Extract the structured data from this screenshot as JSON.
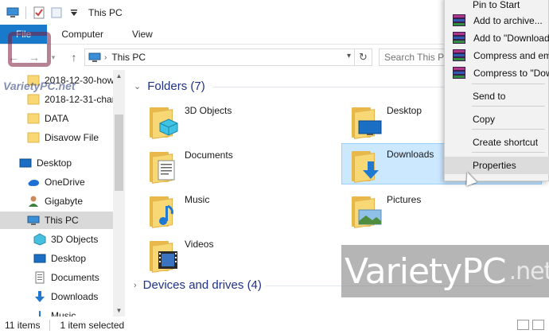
{
  "window": {
    "title": "This PC"
  },
  "ribbon": {
    "tabs": [
      {
        "label": "File"
      },
      {
        "label": "Computer"
      },
      {
        "label": "View"
      }
    ]
  },
  "address": {
    "path": "This PC",
    "search_placeholder": "Search This PC"
  },
  "sidebar": {
    "items": [
      {
        "label": "2018-12-30-how"
      },
      {
        "label": "2018-12-31-char"
      },
      {
        "label": "DATA"
      },
      {
        "label": "Disavow File"
      },
      {
        "label": "Desktop"
      },
      {
        "label": "OneDrive"
      },
      {
        "label": "Gigabyte"
      },
      {
        "label": "This PC"
      },
      {
        "label": "3D Objects"
      },
      {
        "label": "Desktop"
      },
      {
        "label": "Documents"
      },
      {
        "label": "Downloads"
      },
      {
        "label": "Music"
      }
    ]
  },
  "main": {
    "folders_header": "Folders (7)",
    "folders": [
      {
        "label": "3D Objects"
      },
      {
        "label": "Desktop"
      },
      {
        "label": "Documents"
      },
      {
        "label": "Downloads"
      },
      {
        "label": "Music"
      },
      {
        "label": "Pictures"
      },
      {
        "label": "Videos"
      }
    ],
    "devices_header": "Devices and drives (4)"
  },
  "status": {
    "count": "11 items",
    "selected": "1 item selected"
  },
  "context_menu": {
    "items": [
      {
        "label": "Pin to Start"
      },
      {
        "label": "Add to archive..."
      },
      {
        "label": "Add to \"Download"
      },
      {
        "label": "Compress and em"
      },
      {
        "label": "Compress to \"Dow"
      },
      {
        "label": "Send to"
      },
      {
        "label": "Copy"
      },
      {
        "label": "Create shortcut"
      },
      {
        "label": "Properties"
      }
    ]
  },
  "watermark": {
    "brand": "VarietyPC",
    "suffix": ".net",
    "logo_text": "VarietyPC.net"
  },
  "colors": {
    "accent": "#1979ca",
    "selection": "#cce8ff",
    "header_text": "#1e3287",
    "context_bg": "#f2f2f2",
    "folder": "#f8d775"
  }
}
